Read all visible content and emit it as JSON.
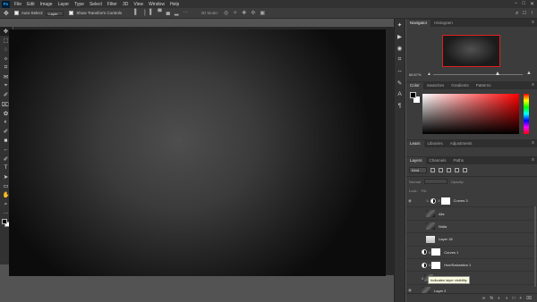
{
  "app": {
    "logo_text": "Ps"
  },
  "menu": [
    "File",
    "Edit",
    "Image",
    "Layer",
    "Type",
    "Select",
    "Filter",
    "3D",
    "View",
    "Window",
    "Help"
  ],
  "window_controls": [
    "−",
    "□",
    "✕"
  ],
  "options_bar": {
    "move_icon": "✥",
    "auto_select_label": "Auto-Select:",
    "auto_select_value": "Layer",
    "transform_label": "Show Transform Controls",
    "align_icons": [
      "▐",
      "▕",
      "▌",
      "▀",
      "▄",
      "▂"
    ],
    "more_icon": "···",
    "mode_3d_label": "3D Mode:",
    "mode_icons": [
      "◎",
      "✧",
      "✚",
      "✣",
      "▣"
    ],
    "right_icons": [
      "⌕",
      "□",
      "↑"
    ]
  },
  "tools": [
    "✥",
    "⬚",
    "◌",
    "✧",
    "⌗",
    "✉",
    "⌖",
    "✐",
    "⌦",
    "✿",
    "◐",
    "✐",
    "■",
    "←",
    "✐",
    "T",
    "➤",
    "▭",
    "✋",
    "⌕",
    "···"
  ],
  "dock_icons": [
    "✦",
    "▶",
    "◉",
    "⌗",
    "↔",
    "✎",
    "A",
    "¶"
  ],
  "navigator": {
    "tabs": [
      "Navigator",
      "Histogram"
    ],
    "zoom": "66.67%"
  },
  "color_panel": {
    "tabs": [
      "Color",
      "Swatches",
      "Gradients",
      "Patterns"
    ]
  },
  "libraries_panel": {
    "tabs": [
      "Learn",
      "Libraries",
      "Adjustments"
    ]
  },
  "layers_panel": {
    "tabs": [
      "Layers",
      "Channels",
      "Paths"
    ],
    "kind_label": "Kind",
    "mode_label": "Normal",
    "opacity_label": "Opacity:",
    "lock_label": "Lock:",
    "fill_label": "Fill:",
    "layers": [
      {
        "name": "Curves 3"
      },
      {
        "name": "Alis"
      },
      {
        "name": "Nidia"
      },
      {
        "name": "Layer 18"
      },
      {
        "name": "Curves 1"
      },
      {
        "name": "Hue/Saturation 1"
      },
      {
        "name": "Layer 4"
      },
      {
        "name": "Layer 2"
      }
    ],
    "tooltip": "Indicates layer visibility",
    "footer_icons": [
      "∞",
      "fx",
      "◐",
      "◑",
      "□",
      "+",
      "⌧"
    ]
  }
}
